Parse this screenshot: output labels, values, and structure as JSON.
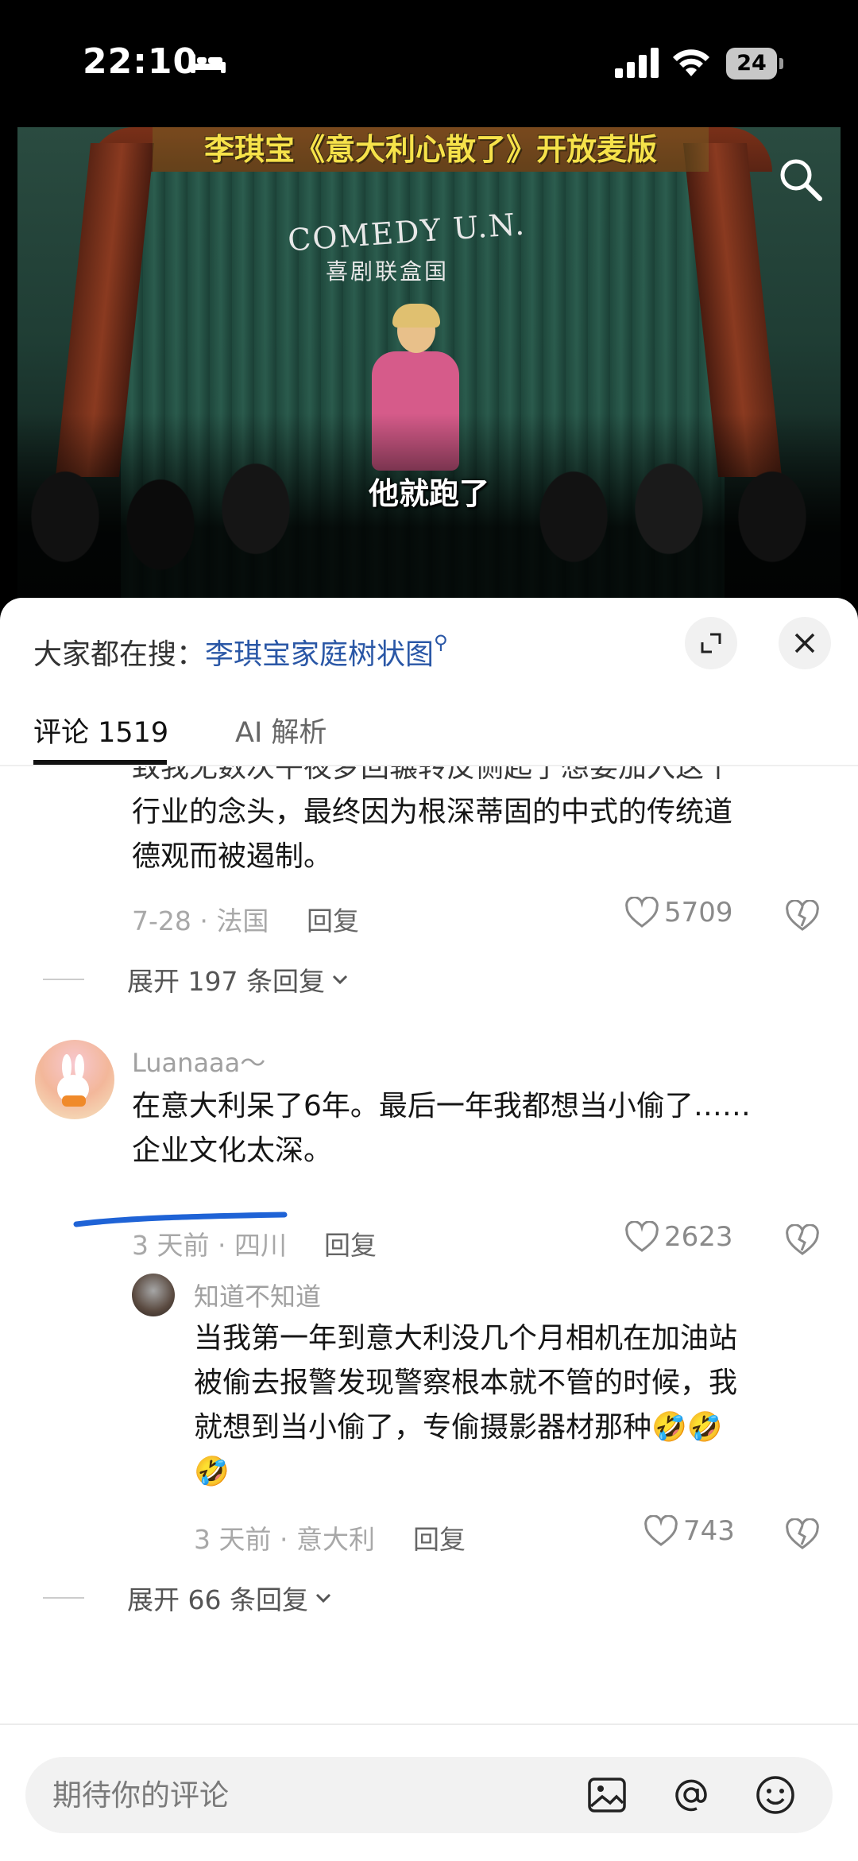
{
  "status_bar": {
    "time": "22:10",
    "battery": "24"
  },
  "video": {
    "title": "李琪宝《意大利心散了》开放麦版",
    "stage_sign_en": "COMEDY U.N.",
    "stage_sign_cn": "喜剧联盒国",
    "subtitle": "他就跑了"
  },
  "search_suggest": {
    "prefix": "大家都在搜：",
    "keyword": "李琪宝家庭树状图"
  },
  "tabs": [
    {
      "label": "评论 1519"
    },
    {
      "label": "AI 解析"
    }
  ],
  "comments": [
    {
      "text_lines": [
        "致我无数次午夜梦回辗转反侧起了想要加入这个",
        "行业的念头，最终因为根深蒂固的中式的传统道",
        "德观而被遏制。"
      ],
      "meta": "7-28 · 法国",
      "reply_label": "回复",
      "likes": "5709",
      "expand_label": "展开 197 条回复"
    },
    {
      "username": "Luanaaa～",
      "text_lines": [
        "在意大利呆了6年。最后一年我都想当小偷了……",
        "企业文化太深。"
      ],
      "meta": "3 天前 · 四川",
      "reply_label": "回复",
      "likes": "2623",
      "reply": {
        "username": "知道不知道",
        "text_lines": [
          "当我第一年到意大利没几个月相机在加油站",
          "被偷去报警发现警察根本就不管的时候，我",
          "就想到当小偷了，专偷摄影器材那种🤣🤣",
          "🤣"
        ],
        "meta": "3 天前 · 意大利",
        "reply_label": "回复",
        "likes": "743"
      },
      "expand_label": "展开 66 条回复"
    }
  ],
  "composer": {
    "placeholder": "期待你的评论"
  },
  "colors": {
    "link": "#2a57a6",
    "highlight_underline": "#1f63d6"
  }
}
